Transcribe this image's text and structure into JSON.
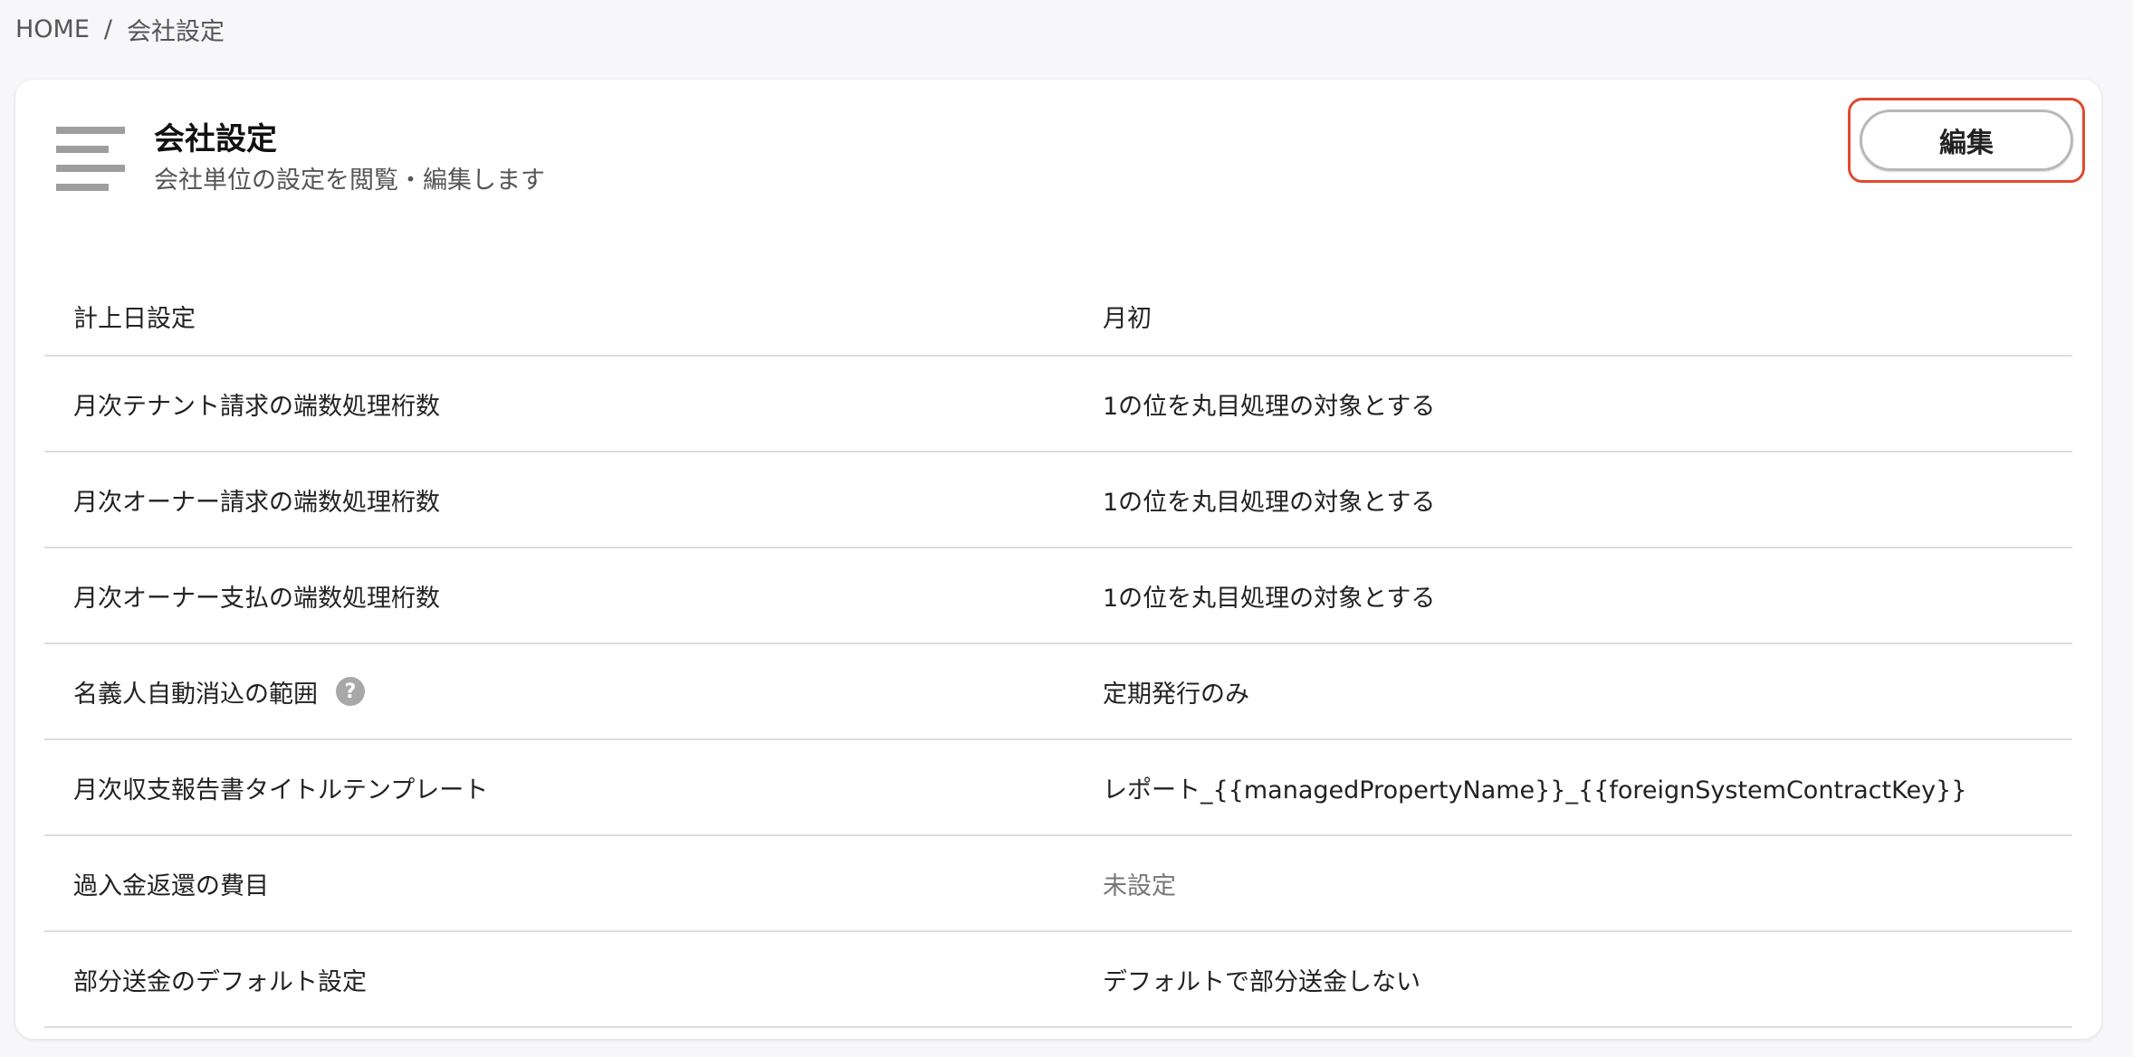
{
  "breadcrumb": {
    "home": "HOME",
    "separator": "/",
    "current": "会社設定"
  },
  "header": {
    "title": "会社設定",
    "subtitle": "会社単位の設定を閲覧・編集します",
    "edit_label": "編集",
    "menu_icon": "list-lines-icon"
  },
  "settings": {
    "rows": [
      {
        "label": "計上日設定",
        "value": "月初"
      },
      {
        "label": "月次テナント請求の端数処理桁数",
        "value": "1の位を丸目処理の対象とする"
      },
      {
        "label": "月次オーナー請求の端数処理桁数",
        "value": "1の位を丸目処理の対象とする"
      },
      {
        "label": "月次オーナー支払の端数処理桁数",
        "value": "1の位を丸目処理の対象とする"
      },
      {
        "label": "名義人自動消込の範囲",
        "value": "定期発行のみ",
        "help": "?"
      },
      {
        "label": "月次収支報告書タイトルテンプレート",
        "value": "レポート_{{managedPropertyName}}_{{foreignSystemContractKey}}"
      },
      {
        "label": "過入金返還の費目",
        "value": "未設定"
      },
      {
        "label": "部分送金のデフォルト設定",
        "value": "デフォルトで部分送金しない"
      }
    ]
  },
  "colors": {
    "highlight": "#e04a2f",
    "background": "#f7f7f9",
    "muted_text": "#777777"
  }
}
